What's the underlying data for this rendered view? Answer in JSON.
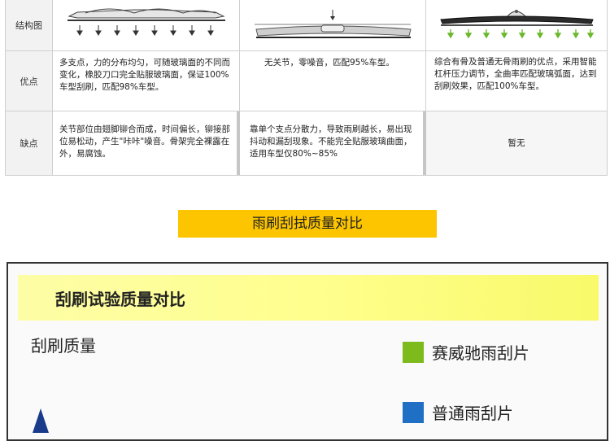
{
  "table": {
    "row_headers": {
      "structure": "结构图",
      "advantages": "优点",
      "disadvantages": "缺点"
    },
    "advantages": {
      "col1": "多支点，力的分布均匀，可随玻璃面的不同而变化，橡胶刀口完全贴服玻璃面，保证100%车型刮刷，匹配98%车型。",
      "col2": "无关节，零噪音，匹配95%车型。",
      "col3": "综合有骨及普通无骨雨刷的优点，采用智能杠杆压力调节，全曲率匹配玻璃弧面，达到刮刷效果，匹配100%车型。"
    },
    "disadvantages": {
      "col1": "关节部位由翅脚铆合而成，时间偏长，铆接部位易松动，产生\"咔咔\"噪音。骨架完全裸露在外，易腐蚀。",
      "col2": "靠单个支点分散力，导致雨刷越长，易出现抖动和漏刮现象。不能完全贴服玻璃曲面，适用车型仅80%~85%",
      "col3": "暂无"
    }
  },
  "banner": {
    "title": "雨刷刮拭质量对比"
  },
  "panel": {
    "title": "刮刷试验质量对比",
    "quality_label": "刮刷质量",
    "legend": [
      {
        "label": "赛威驰雨刮片",
        "color": "#7dba1c"
      },
      {
        "label": "普通雨刮片",
        "color": "#1f6fc4"
      }
    ]
  },
  "colors": {
    "banner": "#fcc500",
    "panel_head": "#ffff8e",
    "green_arrows": "#6ab82b"
  }
}
